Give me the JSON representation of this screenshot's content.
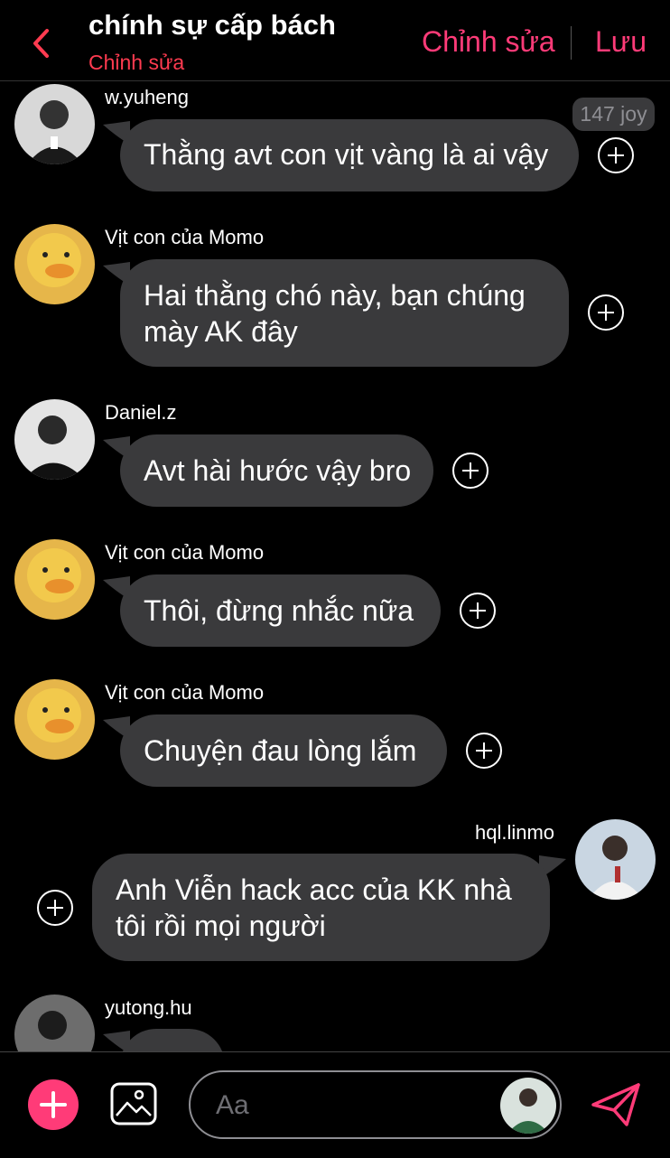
{
  "header": {
    "title": "chính sự cấp bách",
    "subtitle": "Chỉnh sửa",
    "edit_label": "Chỉnh sửa",
    "save_label": "Lưu"
  },
  "reaction_badge": "147 joy",
  "messages": [
    {
      "user": "w.yuheng",
      "text_lines": [
        "Thằng avt con vịt vàng là ai vậy"
      ],
      "side": "left",
      "avatar": "person-photo"
    },
    {
      "user": "Vịt con của Momo",
      "text_lines": [
        "Hai thằng chó này, bạn chúng",
        "mày AK đây"
      ],
      "side": "left",
      "avatar": "yellow-duck"
    },
    {
      "user": "Daniel.z",
      "text_lines": [
        "Avt hài hước vậy bro"
      ],
      "side": "left",
      "avatar": "person-photo"
    },
    {
      "user": "Vịt con của Momo",
      "text_lines": [
        "Thôi, đừng nhắc nữa"
      ],
      "side": "left",
      "avatar": "yellow-duck"
    },
    {
      "user": "Vịt con của Momo",
      "text_lines": [
        "Chuyện đau lòng lắm"
      ],
      "side": "left",
      "avatar": "yellow-duck"
    },
    {
      "user": "hql.linmo",
      "text_lines": [
        "Anh Viễn hack acc của KK nhà",
        "tôi rồi mọi người"
      ],
      "side": "right",
      "avatar": "person-photo"
    },
    {
      "user": "yutong.hu",
      "text_lines": [],
      "side": "left",
      "avatar": "person-photo"
    }
  ],
  "composer": {
    "placeholder": "Aa"
  },
  "colors": {
    "accent": "#ff3b78",
    "subtitle": "#ff3b50",
    "bubble": "#3a3a3c",
    "background": "#000000"
  }
}
